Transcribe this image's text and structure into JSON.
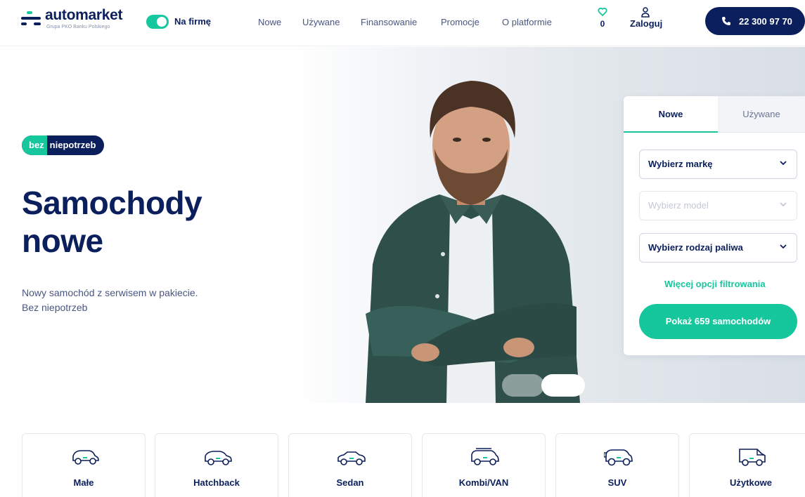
{
  "header": {
    "logo_name": "automarket",
    "logo_sub": "Grupa PKO Banku Polskiego",
    "toggle_label": "Na firmę",
    "nav": [
      "Nowe",
      "Używane",
      "Finansowanie",
      "Promocje",
      "O platformie"
    ],
    "favorites_count": "0",
    "login_label": "Zaloguj",
    "phone": "22 300 97 70"
  },
  "hero": {
    "badge_a": "bez",
    "badge_b": "niepotrzeb",
    "title_line1": "Samochody",
    "title_line2": "nowe",
    "subtitle_line1": "Nowy samochód z serwisem w pakiecie.",
    "subtitle_line2": "Bez niepotrzeb"
  },
  "search": {
    "tabs": [
      "Nowe",
      "Używane"
    ],
    "brand": "Wybierz markę",
    "model": "Wybierz model",
    "fuel": "Wybierz rodzaj paliwa",
    "more_filters": "Więcej opcji filtrowania",
    "submit": "Pokaż  659 samochodów"
  },
  "categories": [
    "Małe",
    "Hatchback",
    "Sedan",
    "Kombi/VAN",
    "SUV",
    "Użytkowe"
  ],
  "colors": {
    "navy": "#0b1f5c",
    "accent": "#16c79e",
    "muted": "#4a5680"
  },
  "icons": [
    "favorite-heart-icon",
    "user-icon",
    "phone-icon",
    "chevron-down-icon",
    "car-icon",
    "van-icon"
  ]
}
